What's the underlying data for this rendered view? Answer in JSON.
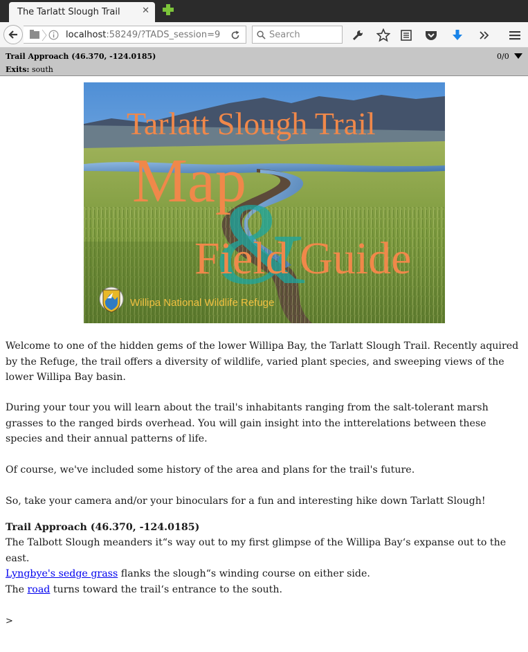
{
  "browser": {
    "tab_title": "The Tarlatt Slough Trail",
    "url_host": "localhost",
    "url_rest": ":58249/?TADS_session=9",
    "search_placeholder": "Search"
  },
  "status": {
    "location": "Trail Approach (46.370, -124.0185)",
    "score": "0/0",
    "exits_label": "Exits:",
    "exits_value": "south"
  },
  "banner": {
    "title_line1": "Tarlatt Slough Trail",
    "title_map": "Map",
    "title_amp": "&",
    "title_field_guide": "Field Guide",
    "refuge_name": "Willipa National Wildlife Refuge"
  },
  "intro": [
    "Welcome to one of the hidden gems of the lower Willipa Bay, the Tarlatt Slough Trail.  Recently aquired by the Refuge, the trail offers a diversity of wildlife, varied plant species, and sweeping views of the lower Willipa Bay basin.",
    "During your tour you will learn about the trail's inhabitants ranging from the salt-tolerant marsh grasses to the ranged birds overhead.  You will gain insight into the intterelations between these species and their annual patterns of life.",
    "Of course, we've included some history of the area and plans for the trail's future.",
    "So, take your camera and/or your binoculars for a fun and interesting hike down Tarlatt Slough!"
  ],
  "room": {
    "title": "Trail Approach (46.370, -124.0185)",
    "desc_part1": "The Talbott Slough meanders it“s way out to my first glimpse of the Willipa Bay‘s expanse out to the east.",
    "sedge_link": "Lyngbye's sedge grass",
    "desc_part2": " flanks the slough“s winding course on either side.",
    "road_prefix": "The ",
    "road_link": "road",
    "road_suffix": " turns toward the trail‘s entrance to the south."
  },
  "prompt": ">",
  "colors": {
    "banner_text": "#f0884a",
    "banner_amp": "#1ca6a0",
    "refuge_text": "#f0c040",
    "link": "#0000ee",
    "status_bg": "#c6c6c6"
  }
}
